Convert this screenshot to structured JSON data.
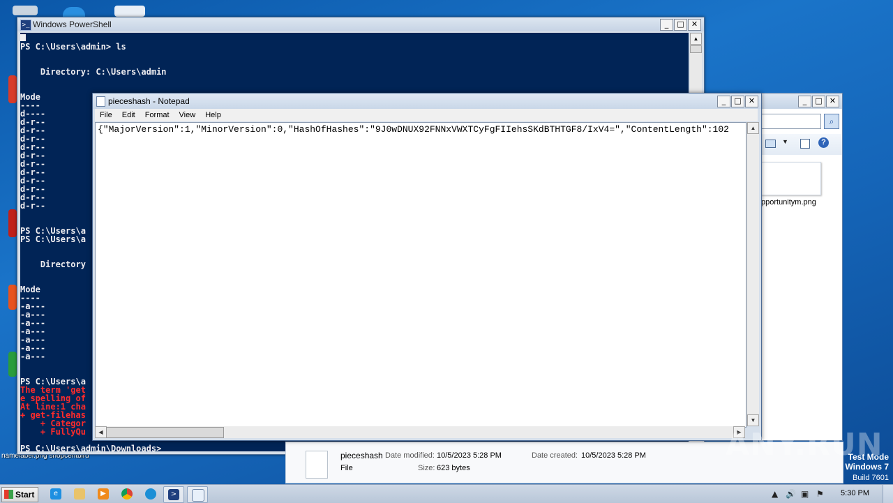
{
  "powershell": {
    "title": "Windows PowerShell",
    "lines": [
      {
        "text": "PS C:\\Users\\admin> ls",
        "err": false
      },
      {
        "text": "",
        "err": false
      },
      {
        "text": "",
        "err": false
      },
      {
        "text": "    Directory: C:\\Users\\admin",
        "err": false
      },
      {
        "text": "",
        "err": false
      },
      {
        "text": "",
        "err": false
      },
      {
        "text": "Mode",
        "err": false
      },
      {
        "text": "----",
        "err": false
      },
      {
        "text": "d----",
        "err": false
      },
      {
        "text": "d-r--",
        "err": false
      },
      {
        "text": "d-r--",
        "err": false
      },
      {
        "text": "d-r--",
        "err": false
      },
      {
        "text": "d-r--",
        "err": false
      },
      {
        "text": "d-r--",
        "err": false
      },
      {
        "text": "d-r--",
        "err": false
      },
      {
        "text": "d-r--",
        "err": false
      },
      {
        "text": "d-r--",
        "err": false
      },
      {
        "text": "d-r--",
        "err": false
      },
      {
        "text": "d-r--",
        "err": false
      },
      {
        "text": "d-r--",
        "err": false
      },
      {
        "text": "",
        "err": false
      },
      {
        "text": "",
        "err": false
      },
      {
        "text": "PS C:\\Users\\a",
        "err": false
      },
      {
        "text": "PS C:\\Users\\a",
        "err": false
      },
      {
        "text": "",
        "err": false
      },
      {
        "text": "",
        "err": false
      },
      {
        "text": "    Directory",
        "err": false
      },
      {
        "text": "",
        "err": false
      },
      {
        "text": "",
        "err": false
      },
      {
        "text": "Mode",
        "err": false
      },
      {
        "text": "----",
        "err": false
      },
      {
        "text": "-a---",
        "err": false
      },
      {
        "text": "-a---",
        "err": false
      },
      {
        "text": "-a---",
        "err": false
      },
      {
        "text": "-a---",
        "err": false
      },
      {
        "text": "-a---",
        "err": false
      },
      {
        "text": "-a---",
        "err": false
      },
      {
        "text": "-a---",
        "err": false
      },
      {
        "text": "",
        "err": false
      },
      {
        "text": "",
        "err": false
      },
      {
        "text": "PS C:\\Users\\a",
        "err": false
      },
      {
        "text": "The term 'get",
        "err": true
      },
      {
        "text": "e spelling of",
        "err": true
      },
      {
        "text": "At line:1 cha",
        "err": true
      },
      {
        "text": "+ get-filehas",
        "err": true
      },
      {
        "text": "    + Categor",
        "err": true
      },
      {
        "text": "    + FullyQu",
        "err": true
      },
      {
        "text": "",
        "err": false
      },
      {
        "text": "PS C:\\Users\\admin\\Downloads>",
        "err": false
      }
    ]
  },
  "notepad": {
    "title": "pieceshash - Notepad",
    "menus": [
      "File",
      "Edit",
      "Format",
      "View",
      "Help"
    ],
    "content": "{\"MajorVersion\":1,\"MinorVersion\":0,\"HashOfHashes\":\"9J0wDNUX92FNNxVWXTCyFgFIIehsSKdBTHTGF8/IxV4=\",\"ContentLength\":102"
  },
  "explorer": {
    "file_label": "pportunitym.png"
  },
  "details": {
    "name": "pieceshash",
    "type": "File",
    "date_modified_label": "Date modified:",
    "date_modified": "10/5/2023 5:28 PM",
    "date_created_label": "Date created:",
    "date_created": "10/5/2023 5:28 PM",
    "size_label": "Size:",
    "size": "623 bytes"
  },
  "desktop": {
    "bottom_label": "namelabel.png shopcentbird"
  },
  "watermark": {
    "text": "ANY.RUN",
    "test_mode": "Test Mode",
    "os": "Windows 7",
    "build": "Build 7601"
  },
  "taskbar": {
    "start_label": "Start",
    "clock": "5:30 PM",
    "apps": [
      "internet-explorer",
      "file-explorer",
      "media-player",
      "chrome",
      "edge",
      "powershell",
      "notepad"
    ]
  }
}
